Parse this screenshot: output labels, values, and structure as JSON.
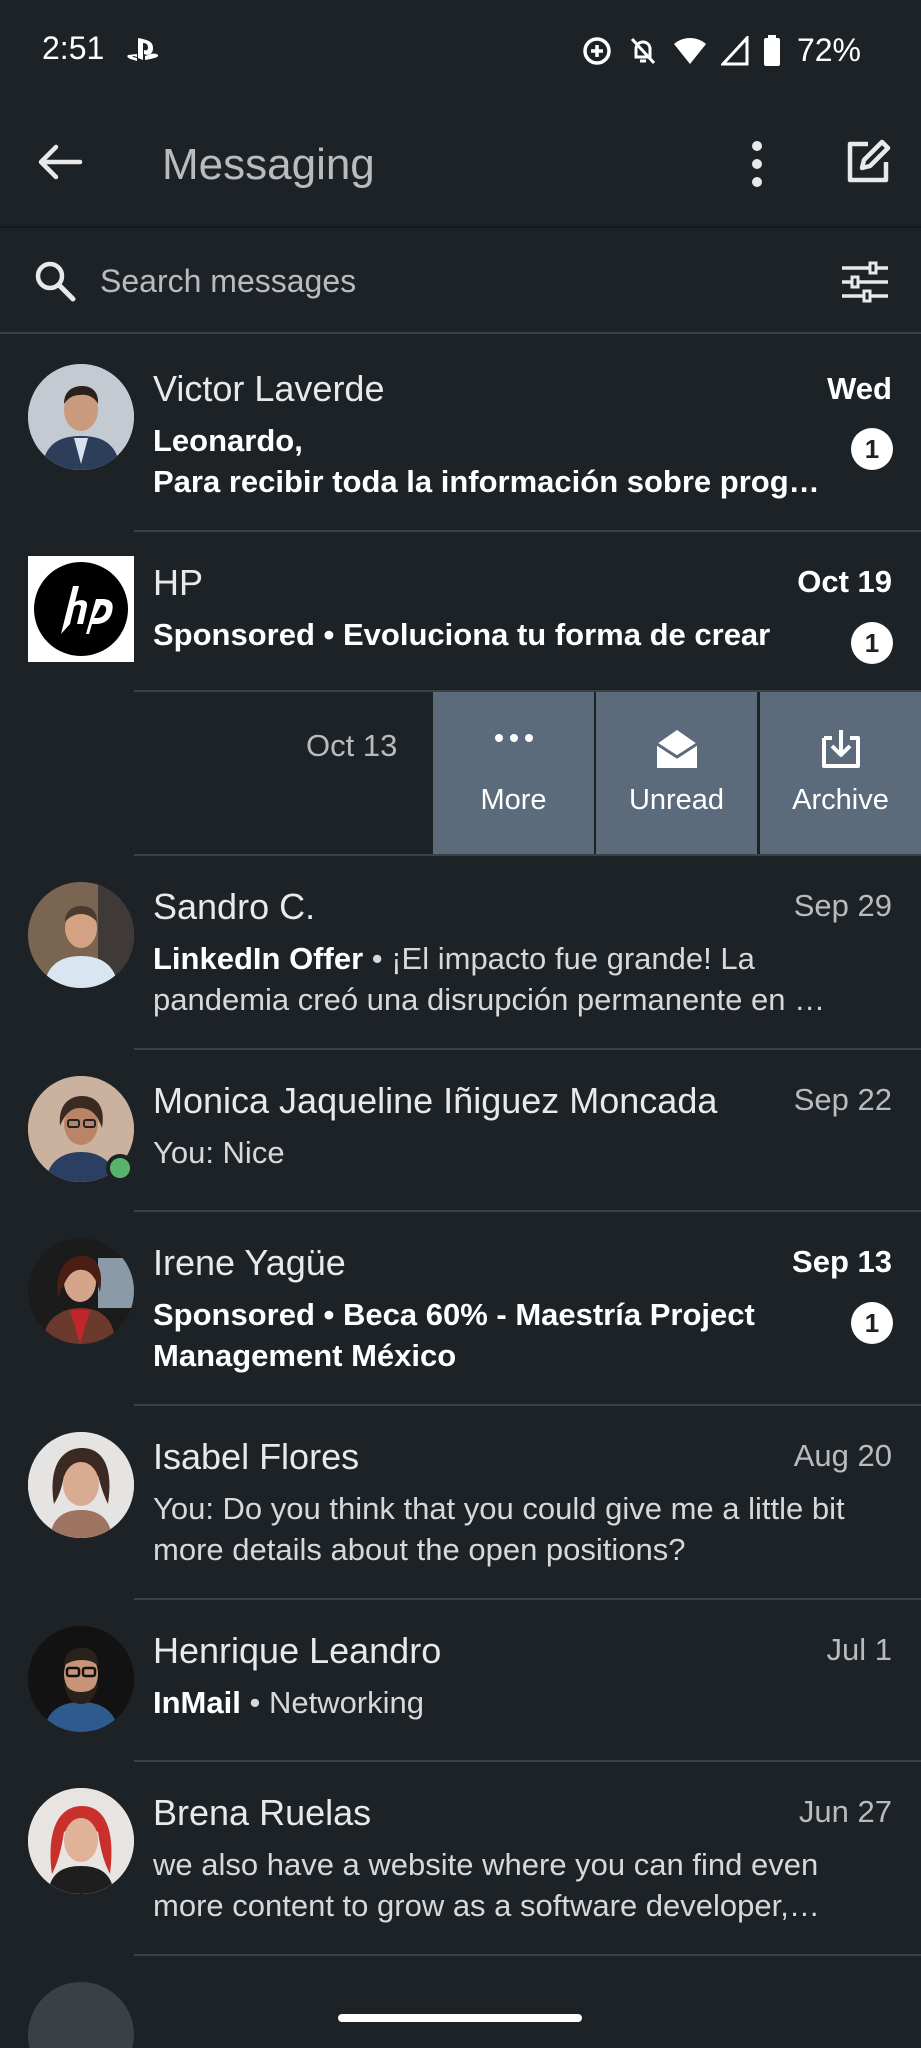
{
  "status_bar": {
    "time": "2:51",
    "icons": [
      "playstation-icon",
      "data-saver-icon",
      "bell-off-icon",
      "wifi-icon",
      "signal-icon",
      "battery-icon"
    ],
    "battery": "72%"
  },
  "app_bar": {
    "title": "Messaging",
    "icons": [
      "back-arrow-icon",
      "more-vert-icon",
      "compose-icon"
    ]
  },
  "search": {
    "placeholder": "Search messages"
  },
  "conversations": [
    {
      "name": "Victor Laverde",
      "date": "Wed",
      "unread": true,
      "badge": "1",
      "preview_lines": [
        "Leonardo,",
        "Para recibir toda la información sobre prog…"
      ]
    },
    {
      "name": "HP",
      "date": "Oct 19",
      "unread": true,
      "badge": "1",
      "tag": "Sponsored",
      "sep": " • ",
      "preview": "Evoluciona tu forma de crear"
    },
    {
      "name": "Sandro C.",
      "date": "Sep 29",
      "unread": false,
      "tag": "LinkedIn Offer",
      "sep": " • ",
      "preview": "¡El impacto fue grande! La pandemia creó una disrupción permanente en …"
    },
    {
      "name": "Monica Jaqueline Iñiguez Moncada",
      "date": "Sep 22",
      "unread": false,
      "preview": "You: Nice"
    },
    {
      "name": "Irene Yagüe",
      "date": "Sep 13",
      "unread": true,
      "badge": "1",
      "tag": "Sponsored",
      "sep": " • ",
      "preview": "Beca 60% - Maestría Project Management México"
    },
    {
      "name": "Isabel Flores",
      "date": "Aug 20",
      "unread": false,
      "preview": "You: Do you think that you could give me a little bit more details about the open positions?"
    },
    {
      "name": "Henrique Leandro",
      "date": "Jul 1",
      "unread": false,
      "tag": "InMail",
      "sep": " • ",
      "preview": "Networking"
    },
    {
      "name": "Brena Ruelas",
      "date": "Jun 27",
      "unread": false,
      "preview": "we also have a website where you can find even more content to grow as a software developer,…"
    }
  ],
  "swipe_row": {
    "date": "Oct 13",
    "actions": [
      {
        "label": "More",
        "icon": "more-horiz-icon"
      },
      {
        "label": "Unread",
        "icon": "envelope-open-icon"
      },
      {
        "label": "Archive",
        "icon": "archive-icon"
      }
    ],
    "action_color": "#5b6b7b"
  },
  "colors": {
    "background": "#1d2226",
    "online": "#57b46c"
  }
}
